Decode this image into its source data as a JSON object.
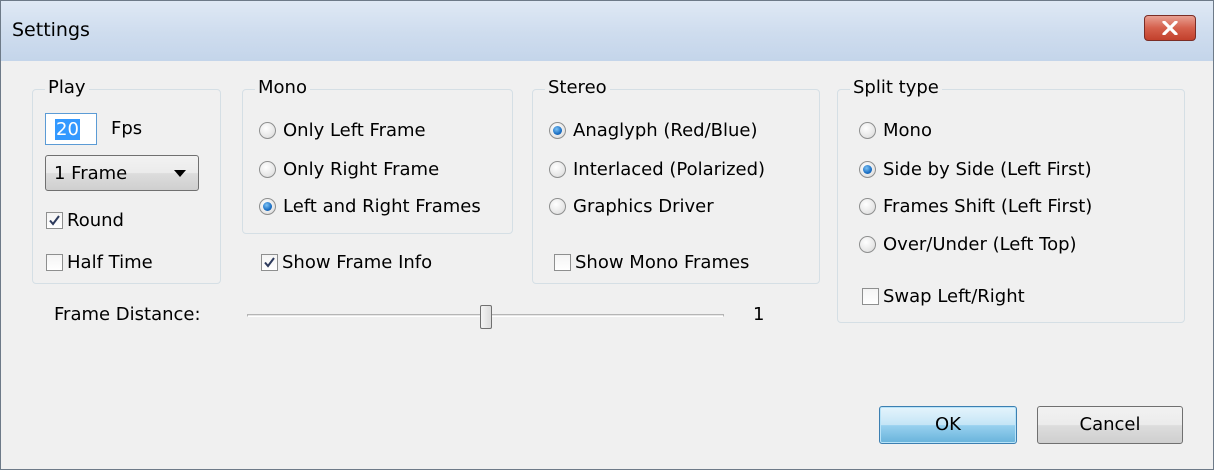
{
  "window": {
    "title": "Settings"
  },
  "play": {
    "title": "Play",
    "fps_value": "20",
    "fps_label": "Fps",
    "frame_select": "1 Frame",
    "round_label": "Round",
    "round_checked": true,
    "half_time_label": "Half Time",
    "half_time_checked": false
  },
  "mono": {
    "title": "Mono",
    "options": [
      {
        "label": "Only Left Frame",
        "selected": false
      },
      {
        "label": "Only Right Frame",
        "selected": false
      },
      {
        "label": "Left and Right Frames",
        "selected": true
      }
    ],
    "show_frame_info_label": "Show Frame Info",
    "show_frame_info_checked": true
  },
  "stereo": {
    "title": "Stereo",
    "options": [
      {
        "label": "Anaglyph (Red/Blue)",
        "selected": true
      },
      {
        "label": "Interlaced (Polarized)",
        "selected": false
      },
      {
        "label": "Graphics Driver",
        "selected": false
      }
    ],
    "show_mono_frames_label": "Show Mono Frames",
    "show_mono_frames_checked": false
  },
  "split": {
    "title": "Split type",
    "options": [
      {
        "label": "Mono",
        "selected": false
      },
      {
        "label": "Side by Side (Left First)",
        "selected": true
      },
      {
        "label": "Frames Shift (Left First)",
        "selected": false
      },
      {
        "label": "Over/Under (Left Top)",
        "selected": false
      }
    ],
    "swap_label": "Swap Left/Right",
    "swap_checked": false
  },
  "frame_distance": {
    "label": "Frame Distance:",
    "value": "1",
    "slider_fraction": 0.5
  },
  "buttons": {
    "ok": "OK",
    "cancel": "Cancel"
  },
  "colors": {
    "accent": "#3399ff",
    "titlebar": "#cedcee",
    "close": "#c84a35"
  },
  "icons": {
    "close": "close-icon",
    "check": "checkmark-icon",
    "dropdown": "chevron-down-icon"
  }
}
